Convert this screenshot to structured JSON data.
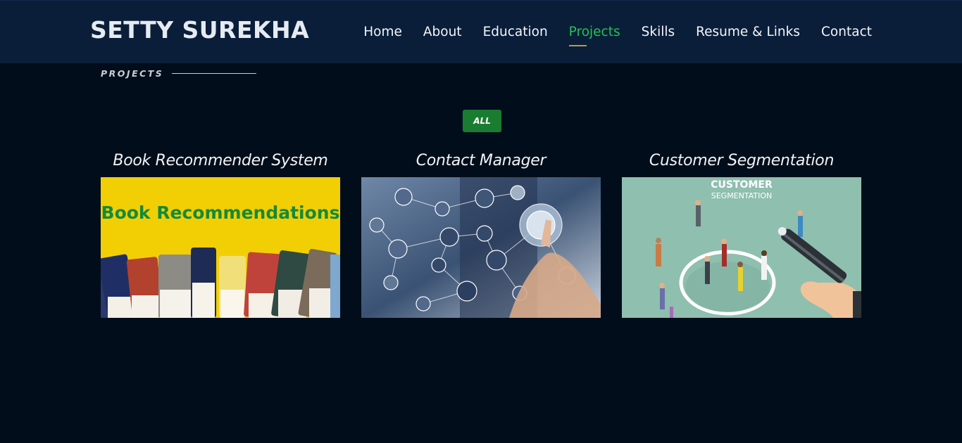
{
  "header": {
    "brand": "SETTY SUREKHA",
    "nav": [
      {
        "label": "Home",
        "active": false
      },
      {
        "label": "About",
        "active": false
      },
      {
        "label": "Education",
        "active": false
      },
      {
        "label": "Projects",
        "active": true
      },
      {
        "label": "Skills",
        "active": false
      },
      {
        "label": "Resume & Links",
        "active": false
      },
      {
        "label": "Contact",
        "active": false
      }
    ]
  },
  "section": {
    "label": "PROJECTS"
  },
  "filters": {
    "all": "ALL"
  },
  "projects": [
    {
      "title": "Book Recommender System",
      "image_text": "Book Recommendations",
      "image_icon": "books-image"
    },
    {
      "title": "Contact Manager",
      "image_icon": "network-contacts-image"
    },
    {
      "title": "Customer Segmentation",
      "image_text_1": "CUSTOMER",
      "image_text_2": "SEGMENTATION",
      "image_icon": "segmentation-illustration-image"
    }
  ],
  "colors": {
    "header_bg": "#0a1e3a",
    "page_bg": "#010d1a",
    "accent_green": "#24c24f",
    "filter_green": "#1a7c30",
    "active_underline": "#bd9a3c"
  }
}
